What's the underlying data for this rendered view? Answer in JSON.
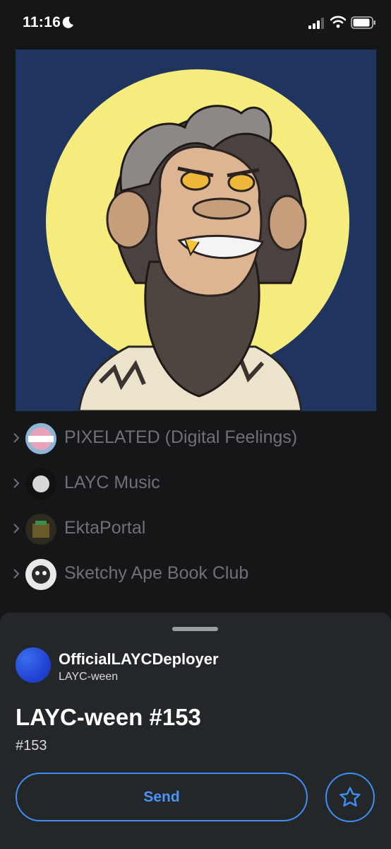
{
  "status_bar": {
    "time": "11:16",
    "icons": [
      "moon-icon",
      "cellular-signal-icon",
      "wifi-icon",
      "battery-icon"
    ]
  },
  "nft_image": {
    "description_icon": "ape-portrait",
    "background_color": "#1f3560",
    "moon_color": "#f6ec7e"
  },
  "collections": [
    {
      "label": "PIXELATED (Digital Feelings)",
      "icon": "chevron-right-icon"
    },
    {
      "label": "LAYC Music",
      "icon": "chevron-right-icon"
    },
    {
      "label": "EktaPortal",
      "icon": "chevron-right-icon"
    },
    {
      "label": "Sketchy Ape Book Club",
      "icon": "chevron-right-icon"
    }
  ],
  "detail_sheet": {
    "owner_name": "OfficialLAYCDeployer",
    "collection_name": "LAYC-ween",
    "title": "LAYC-ween #153",
    "token_number": "#153",
    "send_label": "Send",
    "favorite_icon": "star-icon"
  },
  "colors": {
    "background": "#141618",
    "sheet": "#24272a",
    "accent": "#3f8ef5",
    "muted_text": "#6e7276"
  }
}
